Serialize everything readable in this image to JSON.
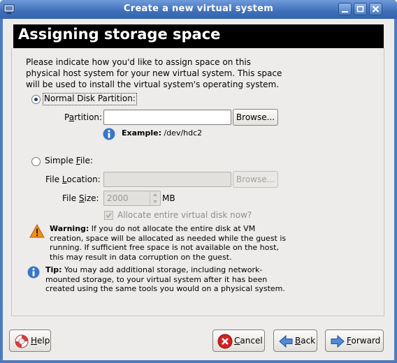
{
  "window": {
    "title": "Create a new virtual system",
    "controls": [
      "minimize-icon",
      "maximize-icon",
      "close-icon"
    ]
  },
  "header": {
    "title": "Assigning storage space"
  },
  "description": {
    "line1": "Please indicate how you'd like to assign space on this",
    "line2": "physical host system for your new virtual system. This space",
    "line3": "will be used to install the virtual system's operating system."
  },
  "partition_option": {
    "label": "Normal Disk Partition:",
    "selected": true,
    "partition_label_pre": "P",
    "partition_label_u": "a",
    "partition_label_post": "rtition:",
    "partition_value": "",
    "browse_label": "Browse...",
    "example_label": "Example:",
    "example_value": " /dev/hdc2"
  },
  "file_option": {
    "label_pre": "Simple ",
    "label_u": "F",
    "label_post": "ile:",
    "selected": false,
    "location_label_pre": "File ",
    "location_label_u": "L",
    "location_label_post": "ocation:",
    "location_value": "",
    "browse_label": "Browse...",
    "size_label_pre": "File ",
    "size_label_u": "S",
    "size_label_post": "ize:",
    "size_value": "2000",
    "size_unit": "MB",
    "allocate_label": "Allocate entire virtual disk now?",
    "allocate_checked": true
  },
  "warning": {
    "bold": "Warning:",
    "line1": " If you do not allocate the entire disk at VM",
    "line2": "creation, space will be allocated as needed while the guest is",
    "line3": "running. If sufficient free space is not available on the host,",
    "line4": "this may result in data corruption on the guest."
  },
  "tip": {
    "bold": "Tip:",
    "line1": " You may add additional storage, including network-",
    "line2": "mounted storage, to your virtual system after it has been",
    "line3": "created using the same tools you would on a physical system."
  },
  "footer": {
    "help": {
      "u": "H",
      "rest": "elp"
    },
    "cancel": {
      "u": "C",
      "rest": "ancel"
    },
    "back": {
      "u": "B",
      "rest": "ack"
    },
    "forward": {
      "u": "F",
      "rest": "orward"
    }
  },
  "colors": {
    "titlebar": "#3f6fb8",
    "header_bg": "#000000",
    "window_bg": "#edeceb",
    "info_blue": "#3a76c4",
    "warning_orange": "#f0901c",
    "cancel_red": "#d32121",
    "arrow_blue": "#2d62b0"
  }
}
